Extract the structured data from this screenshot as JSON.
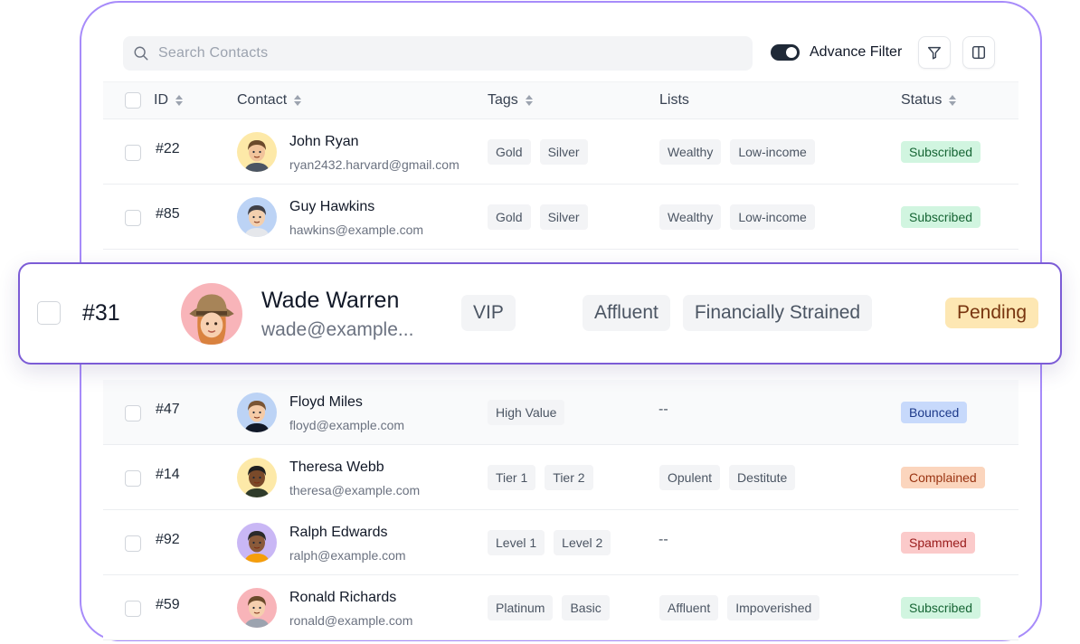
{
  "search": {
    "placeholder": "Search Contacts",
    "icon": "search-icon"
  },
  "toolbar": {
    "advance_filter_label": "Advance Filter",
    "advance_filter_on": true,
    "filter_icon": "filter-icon",
    "columns_icon": "columns-icon"
  },
  "table": {
    "headers": {
      "id": "ID",
      "contact": "Contact",
      "tags": "Tags",
      "lists": "Lists",
      "status": "Status"
    },
    "rows": [
      {
        "id": "#22",
        "name": "John Ryan",
        "email": "ryan2432.harvard@gmail.com",
        "tags": [
          "Gold",
          "Silver"
        ],
        "lists": [
          "Wealthy",
          "Low-income"
        ],
        "status": "Subscribed"
      },
      {
        "id": "#85",
        "name": "Guy Hawkins",
        "email": "hawkins@example.com",
        "tags": [
          "Gold",
          "Silver"
        ],
        "lists": [
          "Wealthy",
          "Low-income"
        ],
        "status": "Subscribed"
      },
      {
        "id": "#47",
        "name": "Floyd Miles",
        "email": "floyd@example.com",
        "tags": [
          "High Value"
        ],
        "lists": "--",
        "status": "Bounced"
      },
      {
        "id": "#14",
        "name": "Theresa Webb",
        "email": "theresa@example.com",
        "tags": [
          "Tier 1",
          "Tier 2"
        ],
        "lists": [
          "Opulent",
          "Destitute"
        ],
        "status": "Complained"
      },
      {
        "id": "#92",
        "name": "Ralph Edwards",
        "email": "ralph@example.com",
        "tags": [
          "Level 1",
          "Level 2"
        ],
        "lists": "--",
        "status": "Spammed"
      },
      {
        "id": "#59",
        "name": "Ronald Richards",
        "email": "ronald@example.com",
        "tags": [
          "Platinum",
          "Basic"
        ],
        "lists": [
          "Affluent",
          "Impoverished"
        ],
        "status": "Subscribed"
      }
    ]
  },
  "featured": {
    "id": "#31",
    "name": "Wade Warren",
    "email": "wade@example...",
    "tags": [
      "VIP"
    ],
    "lists": [
      "Affluent",
      "Financially Strained"
    ],
    "status": "Pending"
  },
  "status_colors": {
    "Subscribed": {
      "bg": "#d1f5e0",
      "fg": "#166534"
    },
    "Bounced": {
      "bg": "#c7d9fb",
      "fg": "#1e3a8a"
    },
    "Complained": {
      "bg": "#fbd5bd",
      "fg": "#9a3412"
    },
    "Spammed": {
      "bg": "#fbcaca",
      "fg": "#991b1b"
    },
    "Pending": {
      "bg": "#fde7b3",
      "fg": "#78350f"
    }
  },
  "colors": {
    "accent_border": "#7c5cd6",
    "frame_border": "#a78bfa"
  }
}
